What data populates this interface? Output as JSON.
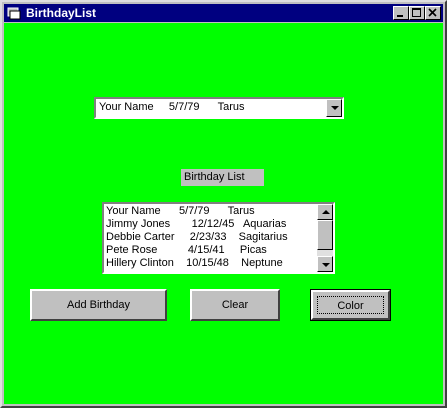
{
  "window": {
    "title": "BirthdayList"
  },
  "combo": {
    "selected": "Your Name     5/7/79      Tarus"
  },
  "label": {
    "text": "Birthday List"
  },
  "list": {
    "items": [
      "Your Name      5/7/79      Tarus",
      "Jimmy Jones       12/12/45   Aquarias",
      "Debbie Carter     2/23/33    Sagitarius",
      "Pete Rose          4/15/41     Picas",
      "Hillery Clinton    10/15/48    Neptune"
    ]
  },
  "buttons": {
    "add": "Add Birthday",
    "clear": "Clear",
    "color": "Color"
  },
  "colors": {
    "form_background": "#00ff00",
    "titlebar": "#000080",
    "control_face": "#c0c0c0"
  }
}
